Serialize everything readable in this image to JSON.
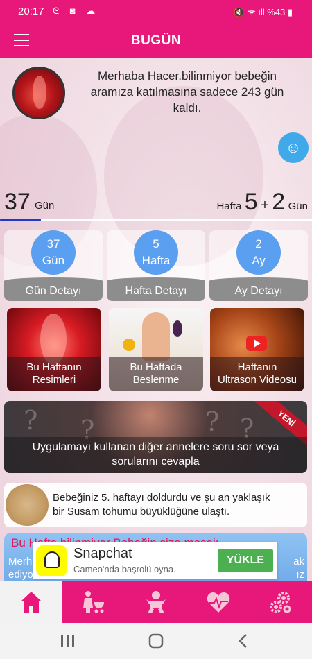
{
  "status_bar": {
    "time": "20:17",
    "battery": "%43"
  },
  "app_bar": {
    "title": "BUGÜN"
  },
  "header": {
    "welcome": "Merhaba Hacer.bilinmiyor bebeğin aramıza katılmasına sadece 243 gün kaldı."
  },
  "progress": {
    "days": "37",
    "days_label": "Gün",
    "week_label": "Hafta",
    "weeks": "5",
    "plus": "+",
    "extra_days": "2",
    "extra_label": "Gün",
    "fraction": 0.13
  },
  "stats": [
    {
      "value": "37",
      "unit": "Gün",
      "detail": "Gün Detayı"
    },
    {
      "value": "5",
      "unit": "Hafta",
      "detail": "Hafta Detayı"
    },
    {
      "value": "2",
      "unit": "Ay",
      "detail": "Ay Detayı"
    }
  ],
  "tiles": [
    {
      "line1": "Bu Haftanın",
      "line2": "Resimleri"
    },
    {
      "line1": "Bu Haftada",
      "line2": "Beslenme"
    },
    {
      "line1": "Haftanın",
      "line2": "Ultrason Videosu"
    }
  ],
  "banner": {
    "ribbon": "YENİ",
    "line1": "Uygulamayı kullanan diğer annelere soru sor veya",
    "line2": "sorularını cevapla"
  },
  "seed": {
    "line1": "Bebeğiniz 5. haftayı doldurdu ve şu an yaklaşık",
    "line2": "bir Susam tohumu büyüklüğüne ulaştı."
  },
  "message": {
    "title": "Bu Hafta bilinmiyor Bebeğin size mesajı",
    "left1": "Merh",
    "left2": "ediyo",
    "right1": "ak",
    "right2": "ız"
  },
  "ad": {
    "title": "Snapchat",
    "subtitle": "Cameo'nda başrolü oyna.",
    "button": "YÜKLE"
  },
  "colors": {
    "primary": "#e8177a",
    "stat_blue": "#5b9ff0",
    "fab_blue": "#3fa9ea",
    "progress": "#1f3ac4"
  }
}
